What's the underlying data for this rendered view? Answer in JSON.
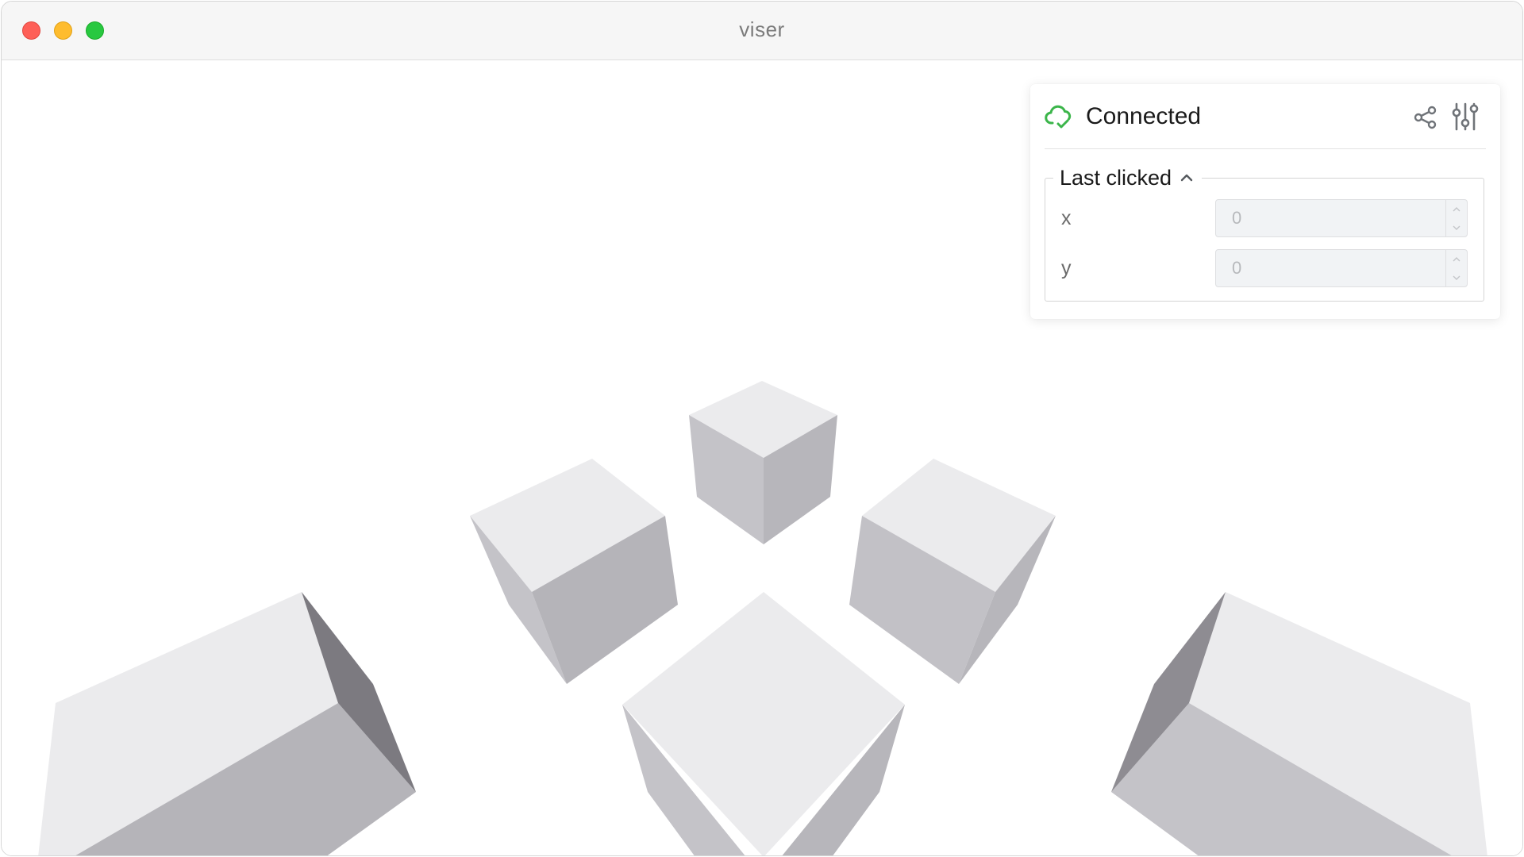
{
  "window": {
    "title": "viser"
  },
  "status": {
    "label": "Connected",
    "icon": "cloud-check-icon",
    "color": "#3bb54a"
  },
  "header_actions": {
    "share_icon": "share-icon",
    "settings_icon": "adjustments-icon"
  },
  "folder": {
    "label": "Last clicked",
    "expanded": true,
    "fields": [
      {
        "label": "x",
        "value": "0"
      },
      {
        "label": "y",
        "value": "0"
      }
    ]
  },
  "colors": {
    "close": "#fe5f57",
    "minimize": "#febc2e",
    "maximize": "#28c840",
    "cube_top": "#ebebed",
    "cube_side_light": "#c4c3c8",
    "cube_side_dark": "#b5b4b9",
    "cube_side_shadow": "#7c7a80"
  }
}
